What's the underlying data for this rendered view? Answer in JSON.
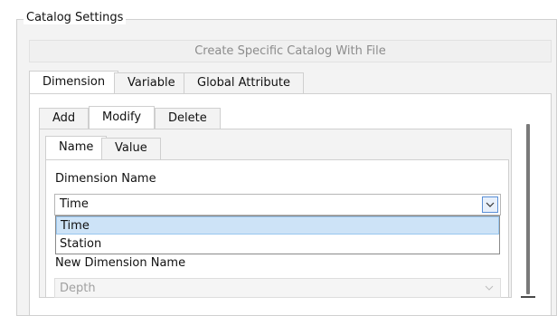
{
  "group": {
    "title": "Catalog Settings"
  },
  "create_button": {
    "label": "Create Specific Catalog With File"
  },
  "top_tabs": [
    {
      "label": "Dimension",
      "active": true
    },
    {
      "label": "Variable",
      "active": false
    },
    {
      "label": "Global Attribute",
      "active": false
    }
  ],
  "action_tabs": [
    {
      "label": "Add",
      "active": false
    },
    {
      "label": "Modify",
      "active": true
    },
    {
      "label": "Delete",
      "active": false
    }
  ],
  "field_tabs": [
    {
      "label": "Name",
      "active": true
    },
    {
      "label": "Value",
      "active": false
    }
  ],
  "dimension_name": {
    "label": "Dimension Name",
    "selected": "Time",
    "options": [
      "Time",
      "Station"
    ],
    "highlighted": "Time"
  },
  "new_dimension_name": {
    "label": "New Dimension Name",
    "value": "Depth"
  },
  "icons": {
    "dropdown": "chevron-down-icon"
  }
}
